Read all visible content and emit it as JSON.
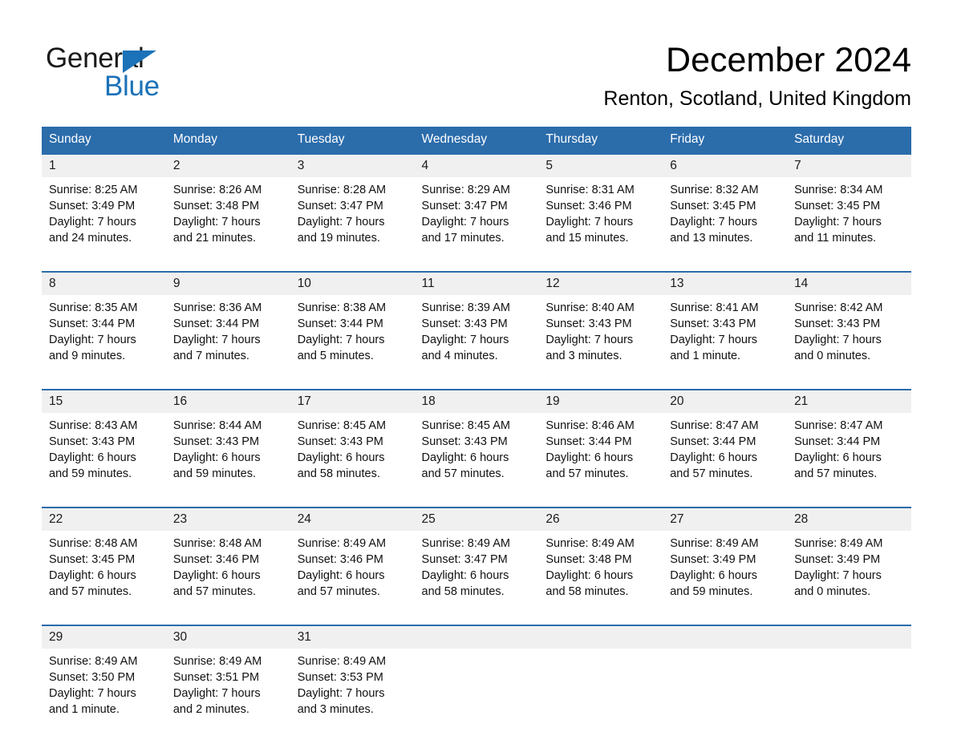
{
  "brand": {
    "name_part1": "General",
    "name_part2": "Blue"
  },
  "header": {
    "month_title": "December 2024",
    "location": "Renton, Scotland, United Kingdom"
  },
  "colors": {
    "header_blue": "#2b6cab",
    "brand_blue": "#1b72b8",
    "day_band_gray": "#f0f0f0",
    "page_background": "#ffffff"
  },
  "weekday_headers": [
    "Sunday",
    "Monday",
    "Tuesday",
    "Wednesday",
    "Thursday",
    "Friday",
    "Saturday"
  ],
  "weeks": [
    {
      "days": [
        {
          "day": "1",
          "sunrise": "Sunrise: 8:25 AM",
          "sunset": "Sunset: 3:49 PM",
          "daylight_line1": "Daylight: 7 hours",
          "daylight_line2": "and 24 minutes."
        },
        {
          "day": "2",
          "sunrise": "Sunrise: 8:26 AM",
          "sunset": "Sunset: 3:48 PM",
          "daylight_line1": "Daylight: 7 hours",
          "daylight_line2": "and 21 minutes."
        },
        {
          "day": "3",
          "sunrise": "Sunrise: 8:28 AM",
          "sunset": "Sunset: 3:47 PM",
          "daylight_line1": "Daylight: 7 hours",
          "daylight_line2": "and 19 minutes."
        },
        {
          "day": "4",
          "sunrise": "Sunrise: 8:29 AM",
          "sunset": "Sunset: 3:47 PM",
          "daylight_line1": "Daylight: 7 hours",
          "daylight_line2": "and 17 minutes."
        },
        {
          "day": "5",
          "sunrise": "Sunrise: 8:31 AM",
          "sunset": "Sunset: 3:46 PM",
          "daylight_line1": "Daylight: 7 hours",
          "daylight_line2": "and 15 minutes."
        },
        {
          "day": "6",
          "sunrise": "Sunrise: 8:32 AM",
          "sunset": "Sunset: 3:45 PM",
          "daylight_line1": "Daylight: 7 hours",
          "daylight_line2": "and 13 minutes."
        },
        {
          "day": "7",
          "sunrise": "Sunrise: 8:34 AM",
          "sunset": "Sunset: 3:45 PM",
          "daylight_line1": "Daylight: 7 hours",
          "daylight_line2": "and 11 minutes."
        }
      ]
    },
    {
      "days": [
        {
          "day": "8",
          "sunrise": "Sunrise: 8:35 AM",
          "sunset": "Sunset: 3:44 PM",
          "daylight_line1": "Daylight: 7 hours",
          "daylight_line2": "and 9 minutes."
        },
        {
          "day": "9",
          "sunrise": "Sunrise: 8:36 AM",
          "sunset": "Sunset: 3:44 PM",
          "daylight_line1": "Daylight: 7 hours",
          "daylight_line2": "and 7 minutes."
        },
        {
          "day": "10",
          "sunrise": "Sunrise: 8:38 AM",
          "sunset": "Sunset: 3:44 PM",
          "daylight_line1": "Daylight: 7 hours",
          "daylight_line2": "and 5 minutes."
        },
        {
          "day": "11",
          "sunrise": "Sunrise: 8:39 AM",
          "sunset": "Sunset: 3:43 PM",
          "daylight_line1": "Daylight: 7 hours",
          "daylight_line2": "and 4 minutes."
        },
        {
          "day": "12",
          "sunrise": "Sunrise: 8:40 AM",
          "sunset": "Sunset: 3:43 PM",
          "daylight_line1": "Daylight: 7 hours",
          "daylight_line2": "and 3 minutes."
        },
        {
          "day": "13",
          "sunrise": "Sunrise: 8:41 AM",
          "sunset": "Sunset: 3:43 PM",
          "daylight_line1": "Daylight: 7 hours",
          "daylight_line2": "and 1 minute."
        },
        {
          "day": "14",
          "sunrise": "Sunrise: 8:42 AM",
          "sunset": "Sunset: 3:43 PM",
          "daylight_line1": "Daylight: 7 hours",
          "daylight_line2": "and 0 minutes."
        }
      ]
    },
    {
      "days": [
        {
          "day": "15",
          "sunrise": "Sunrise: 8:43 AM",
          "sunset": "Sunset: 3:43 PM",
          "daylight_line1": "Daylight: 6 hours",
          "daylight_line2": "and 59 minutes."
        },
        {
          "day": "16",
          "sunrise": "Sunrise: 8:44 AM",
          "sunset": "Sunset: 3:43 PM",
          "daylight_line1": "Daylight: 6 hours",
          "daylight_line2": "and 59 minutes."
        },
        {
          "day": "17",
          "sunrise": "Sunrise: 8:45 AM",
          "sunset": "Sunset: 3:43 PM",
          "daylight_line1": "Daylight: 6 hours",
          "daylight_line2": "and 58 minutes."
        },
        {
          "day": "18",
          "sunrise": "Sunrise: 8:45 AM",
          "sunset": "Sunset: 3:43 PM",
          "daylight_line1": "Daylight: 6 hours",
          "daylight_line2": "and 57 minutes."
        },
        {
          "day": "19",
          "sunrise": "Sunrise: 8:46 AM",
          "sunset": "Sunset: 3:44 PM",
          "daylight_line1": "Daylight: 6 hours",
          "daylight_line2": "and 57 minutes."
        },
        {
          "day": "20",
          "sunrise": "Sunrise: 8:47 AM",
          "sunset": "Sunset: 3:44 PM",
          "daylight_line1": "Daylight: 6 hours",
          "daylight_line2": "and 57 minutes."
        },
        {
          "day": "21",
          "sunrise": "Sunrise: 8:47 AM",
          "sunset": "Sunset: 3:44 PM",
          "daylight_line1": "Daylight: 6 hours",
          "daylight_line2": "and 57 minutes."
        }
      ]
    },
    {
      "days": [
        {
          "day": "22",
          "sunrise": "Sunrise: 8:48 AM",
          "sunset": "Sunset: 3:45 PM",
          "daylight_line1": "Daylight: 6 hours",
          "daylight_line2": "and 57 minutes."
        },
        {
          "day": "23",
          "sunrise": "Sunrise: 8:48 AM",
          "sunset": "Sunset: 3:46 PM",
          "daylight_line1": "Daylight: 6 hours",
          "daylight_line2": "and 57 minutes."
        },
        {
          "day": "24",
          "sunrise": "Sunrise: 8:49 AM",
          "sunset": "Sunset: 3:46 PM",
          "daylight_line1": "Daylight: 6 hours",
          "daylight_line2": "and 57 minutes."
        },
        {
          "day": "25",
          "sunrise": "Sunrise: 8:49 AM",
          "sunset": "Sunset: 3:47 PM",
          "daylight_line1": "Daylight: 6 hours",
          "daylight_line2": "and 58 minutes."
        },
        {
          "day": "26",
          "sunrise": "Sunrise: 8:49 AM",
          "sunset": "Sunset: 3:48 PM",
          "daylight_line1": "Daylight: 6 hours",
          "daylight_line2": "and 58 minutes."
        },
        {
          "day": "27",
          "sunrise": "Sunrise: 8:49 AM",
          "sunset": "Sunset: 3:49 PM",
          "daylight_line1": "Daylight: 6 hours",
          "daylight_line2": "and 59 minutes."
        },
        {
          "day": "28",
          "sunrise": "Sunrise: 8:49 AM",
          "sunset": "Sunset: 3:49 PM",
          "daylight_line1": "Daylight: 7 hours",
          "daylight_line2": "and 0 minutes."
        }
      ]
    },
    {
      "days": [
        {
          "day": "29",
          "sunrise": "Sunrise: 8:49 AM",
          "sunset": "Sunset: 3:50 PM",
          "daylight_line1": "Daylight: 7 hours",
          "daylight_line2": "and 1 minute."
        },
        {
          "day": "30",
          "sunrise": "Sunrise: 8:49 AM",
          "sunset": "Sunset: 3:51 PM",
          "daylight_line1": "Daylight: 7 hours",
          "daylight_line2": "and 2 minutes."
        },
        {
          "day": "31",
          "sunrise": "Sunrise: 8:49 AM",
          "sunset": "Sunset: 3:53 PM",
          "daylight_line1": "Daylight: 7 hours",
          "daylight_line2": "and 3 minutes."
        },
        {
          "day": "",
          "sunrise": "",
          "sunset": "",
          "daylight_line1": "",
          "daylight_line2": ""
        },
        {
          "day": "",
          "sunrise": "",
          "sunset": "",
          "daylight_line1": "",
          "daylight_line2": ""
        },
        {
          "day": "",
          "sunrise": "",
          "sunset": "",
          "daylight_line1": "",
          "daylight_line2": ""
        },
        {
          "day": "",
          "sunrise": "",
          "sunset": "",
          "daylight_line1": "",
          "daylight_line2": ""
        }
      ]
    }
  ]
}
